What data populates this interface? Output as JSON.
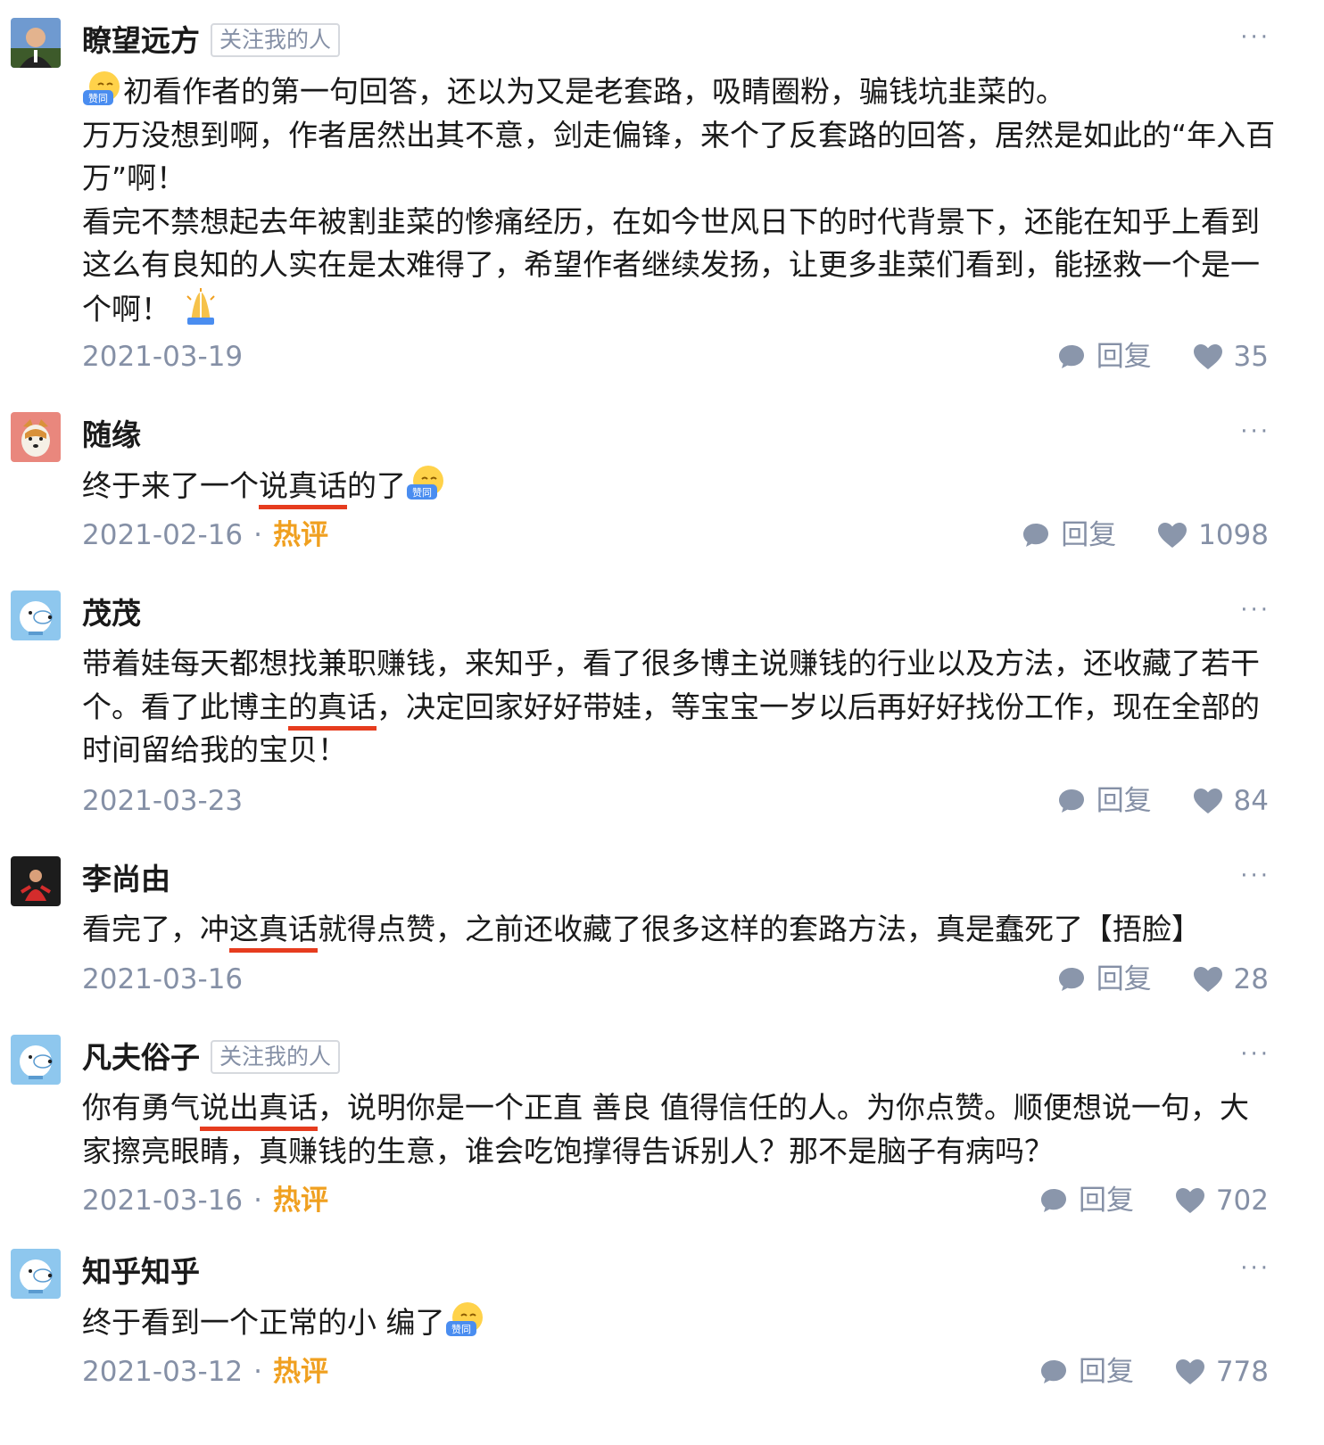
{
  "colors": {
    "text": "#1a1a1a",
    "meta": "#8590a6",
    "hot": "#f0a020",
    "annotation": "#e63c1e"
  },
  "comments": [
    {
      "author": "瞭望远方",
      "tag": "关注我的人",
      "emoji_label": "赞同",
      "lines": [
        "初看作者的第一句回答，还以为又是老套路，吸睛圈粉，骗钱坑韭菜的。",
        "万万没想到啊，作者居然出其不意，剑走偏锋，来个了反套路的回答，居然是如此的“年入百万”啊！",
        "看完不禁想起去年被割韭菜的惨痛经历，在如今世风日下的时代背景下，还能在知乎上看到这么有良知的人实在是太难得了，希望作者继续发扬，让更多韭菜们看到，能拯救一个是一个啊！"
      ],
      "date": "2021-03-19",
      "reply": "回复",
      "likes": "35"
    },
    {
      "author": "随缘",
      "text_before": "终于来了一个",
      "text_marked": "说真话",
      "text_after": "的了",
      "emoji_label": "赞同",
      "date": "2021-02-16",
      "hot": "热评",
      "reply": "回复",
      "likes": "1098"
    },
    {
      "author": "茂茂",
      "text_before": "带着娃每天都想找兼职赚钱，来知乎，看了很多博主说赚钱的行业以及方法，还收藏了若干个。看了此博主",
      "text_marked": "的真话",
      "text_after": "，决定回家好好带娃，等宝宝一岁以后再好好找份工作，现在全部的时间留给我的宝贝！",
      "date": "2021-03-23",
      "reply": "回复",
      "likes": "84"
    },
    {
      "author": "李尚由",
      "text_before": "看完了，冲",
      "text_marked": "这真话",
      "text_after": "就得点赞，之前还收藏了很多这样的套路方法，真是蠢死了【捂脸】",
      "date": "2021-03-16",
      "reply": "回复",
      "likes": "28"
    },
    {
      "author": "凡夫俗子",
      "tag": "关注我的人",
      "text_before": "你有勇气",
      "text_marked": "说出真话",
      "text_after": "，说明你是一个正直 善良 值得信任的人。为你点赞。顺便想说一句，大家擦亮眼睛，真赚钱的生意，谁会吃饱撑得告诉别人？那不是脑子有病吗？",
      "date": "2021-03-16",
      "hot": "热评",
      "reply": "回复",
      "likes": "702"
    },
    {
      "author": "知乎知乎",
      "text": "终于看到一个正常的小 编了",
      "emoji_label": "赞同",
      "date": "2021-03-12",
      "hot": "热评",
      "reply": "回复",
      "likes": "778"
    }
  ],
  "more_label": "···",
  "dot": "·"
}
